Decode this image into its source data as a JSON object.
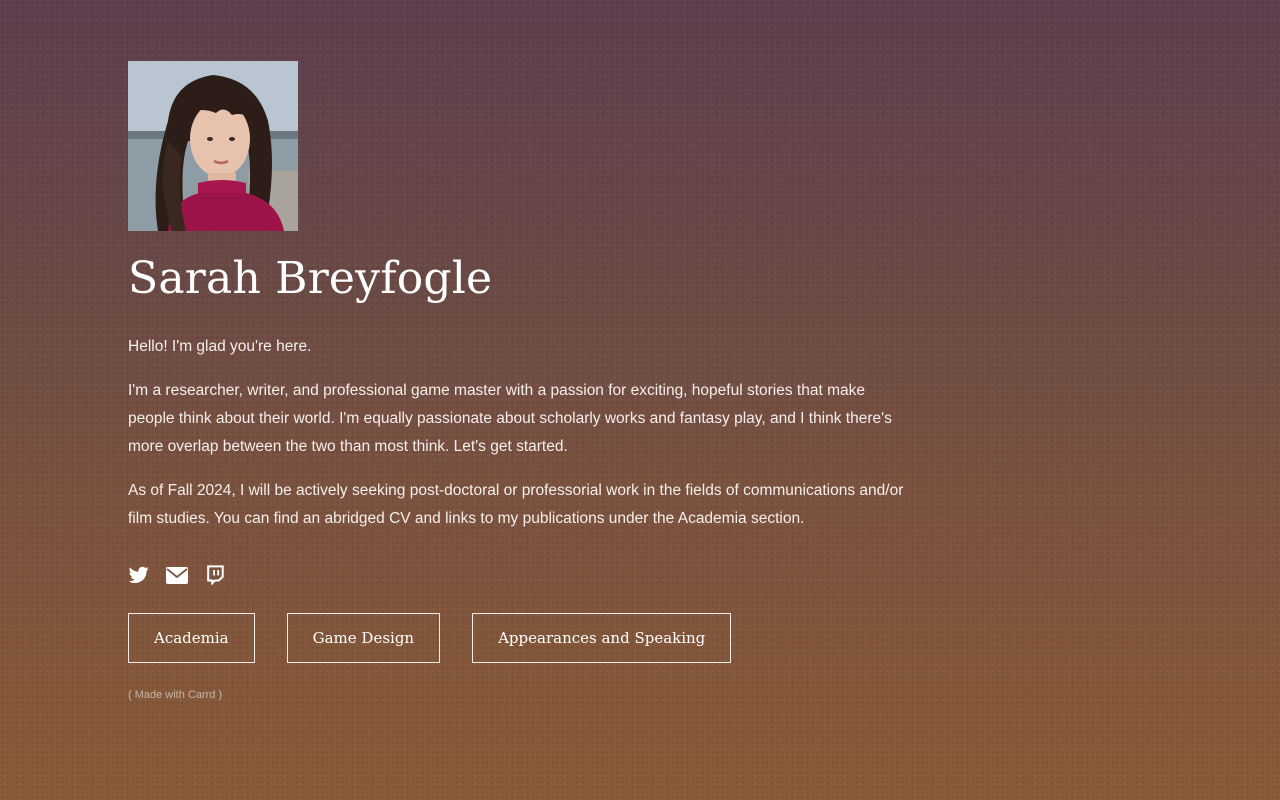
{
  "profile": {
    "photo_alt": "Portrait photo",
    "name": "Sarah Breyfogle"
  },
  "intro": {
    "greeting": "Hello! I'm glad you're here.",
    "bio": "I'm a researcher, writer, and professional game master with a passion for exciting, hopeful stories that make people think about their world. I'm equally passionate about scholarly works and fantasy play, and I think there's more overlap between the two than most think. Let's get started.",
    "status": "As of Fall 2024, I will be actively seeking post-doctoral or professorial work in the fields of communications and/or film studies. You can find an abridged CV and links to my publications under the Academia section."
  },
  "social": [
    {
      "icon": "twitter-icon"
    },
    {
      "icon": "envelope-icon"
    },
    {
      "icon": "twitch-icon"
    }
  ],
  "buttons": {
    "academia": "Academia",
    "game_design": "Game Design",
    "appearances": "Appearances and Speaking"
  },
  "footer": {
    "credit": "( Made with Carrd )"
  },
  "colors": {
    "bg_top": "#5e3f4e",
    "bg_bottom": "#8a5b35",
    "text": "#f5efec"
  }
}
